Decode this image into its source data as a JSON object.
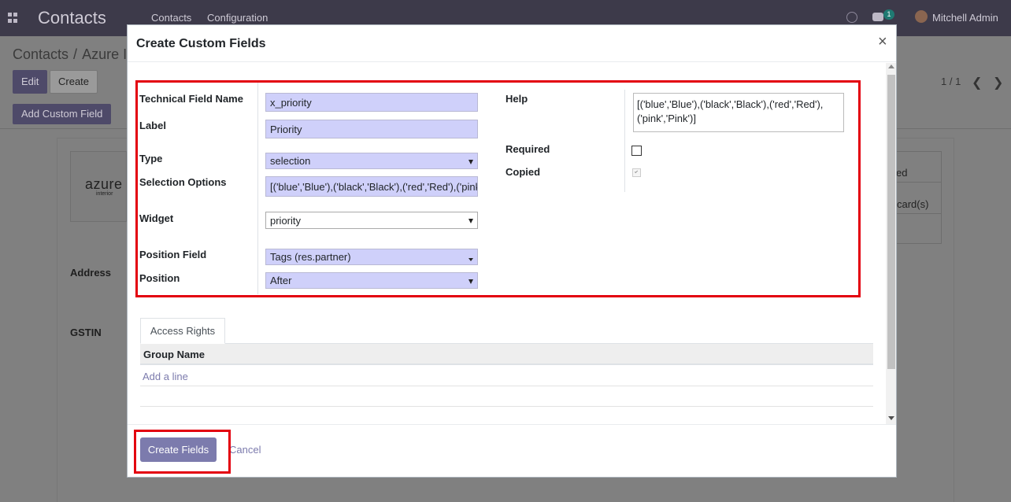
{
  "topbar": {
    "app_title": "Contacts",
    "menu": [
      "Contacts",
      "Configuration"
    ],
    "chat_badge": "1",
    "user_name": "Mitchell Admin"
  },
  "breadcrumb": {
    "parent": "Contacts",
    "separator": "/",
    "current": "Azure I"
  },
  "toolbar": {
    "edit_label": "Edit",
    "create_label": "Create",
    "add_custom_field_label": "Add Custom Field"
  },
  "pager": {
    "text": "1 / 1"
  },
  "background_form": {
    "logo_text": "azure",
    "logo_subtext": "interior",
    "address_label": "Address",
    "gstin_label": "GSTIN",
    "side_texts": [
      "ed",
      "card(s)"
    ]
  },
  "modal": {
    "title": "Create Custom Fields",
    "close_symbol": "×",
    "fields": {
      "technical_field_name": {
        "label": "Technical Field Name",
        "value": "x_priority"
      },
      "label": {
        "label": "Label",
        "value": "Priority"
      },
      "type": {
        "label": "Type",
        "value": "selection"
      },
      "selection_options": {
        "label": "Selection Options",
        "value": "[('blue','Blue'),('black','Black'),('red','Red'),('pink','Pink')]"
      },
      "widget": {
        "label": "Widget",
        "value": "priority"
      },
      "position_field": {
        "label": "Position Field",
        "value": "Tags (res.partner)"
      },
      "position": {
        "label": "Position",
        "value": "After"
      },
      "help": {
        "label": "Help",
        "value": "[('blue','Blue'),('black','Black'),('red','Red'),\n('pink','Pink')]"
      },
      "required": {
        "label": "Required",
        "checked": false
      },
      "copied": {
        "label": "Copied",
        "checked": true
      }
    },
    "tabs": [
      "Access Rights"
    ],
    "table": {
      "columns": [
        "Group Name"
      ],
      "add_line_label": "Add a line"
    },
    "footer": {
      "create_label": "Create Fields",
      "cancel_label": "Cancel"
    }
  },
  "colors": {
    "highlight": "#e3000f",
    "primary": "#7c7bad",
    "input_bg": "#cfd0fa"
  }
}
